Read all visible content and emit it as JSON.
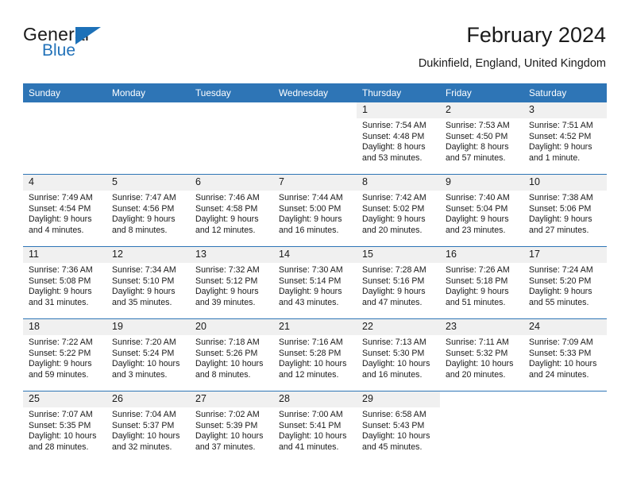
{
  "brand": {
    "name_top": "General",
    "name_bottom": "Blue",
    "triangle_color": "#1d71b8",
    "text_color": "#2272b9"
  },
  "header": {
    "title": "February 2024",
    "location": "Dukinfield, England, United Kingdom"
  },
  "theme": {
    "header_bg": "#2e75b6",
    "header_text": "#ffffff",
    "daynum_bg": "#f0f0f0",
    "row_divider": "#2e75b6",
    "page_bg": "#ffffff"
  },
  "calendar": {
    "weekday_headers": [
      "Sunday",
      "Monday",
      "Tuesday",
      "Wednesday",
      "Thursday",
      "Friday",
      "Saturday"
    ],
    "labels": {
      "sunrise": "Sunrise:",
      "sunset": "Sunset:",
      "daylight": "Daylight:"
    },
    "weeks": [
      [
        {
          "day": "",
          "blank": true
        },
        {
          "day": "",
          "blank": true
        },
        {
          "day": "",
          "blank": true
        },
        {
          "day": "",
          "blank": true
        },
        {
          "day": "1",
          "sunrise": "Sunrise: 7:54 AM",
          "sunset": "Sunset: 4:48 PM",
          "daylight1": "Daylight: 8 hours",
          "daylight2": "and 53 minutes."
        },
        {
          "day": "2",
          "sunrise": "Sunrise: 7:53 AM",
          "sunset": "Sunset: 4:50 PM",
          "daylight1": "Daylight: 8 hours",
          "daylight2": "and 57 minutes."
        },
        {
          "day": "3",
          "sunrise": "Sunrise: 7:51 AM",
          "sunset": "Sunset: 4:52 PM",
          "daylight1": "Daylight: 9 hours",
          "daylight2": "and 1 minute."
        }
      ],
      [
        {
          "day": "4",
          "sunrise": "Sunrise: 7:49 AM",
          "sunset": "Sunset: 4:54 PM",
          "daylight1": "Daylight: 9 hours",
          "daylight2": "and 4 minutes."
        },
        {
          "day": "5",
          "sunrise": "Sunrise: 7:47 AM",
          "sunset": "Sunset: 4:56 PM",
          "daylight1": "Daylight: 9 hours",
          "daylight2": "and 8 minutes."
        },
        {
          "day": "6",
          "sunrise": "Sunrise: 7:46 AM",
          "sunset": "Sunset: 4:58 PM",
          "daylight1": "Daylight: 9 hours",
          "daylight2": "and 12 minutes."
        },
        {
          "day": "7",
          "sunrise": "Sunrise: 7:44 AM",
          "sunset": "Sunset: 5:00 PM",
          "daylight1": "Daylight: 9 hours",
          "daylight2": "and 16 minutes."
        },
        {
          "day": "8",
          "sunrise": "Sunrise: 7:42 AM",
          "sunset": "Sunset: 5:02 PM",
          "daylight1": "Daylight: 9 hours",
          "daylight2": "and 20 minutes."
        },
        {
          "day": "9",
          "sunrise": "Sunrise: 7:40 AM",
          "sunset": "Sunset: 5:04 PM",
          "daylight1": "Daylight: 9 hours",
          "daylight2": "and 23 minutes."
        },
        {
          "day": "10",
          "sunrise": "Sunrise: 7:38 AM",
          "sunset": "Sunset: 5:06 PM",
          "daylight1": "Daylight: 9 hours",
          "daylight2": "and 27 minutes."
        }
      ],
      [
        {
          "day": "11",
          "sunrise": "Sunrise: 7:36 AM",
          "sunset": "Sunset: 5:08 PM",
          "daylight1": "Daylight: 9 hours",
          "daylight2": "and 31 minutes."
        },
        {
          "day": "12",
          "sunrise": "Sunrise: 7:34 AM",
          "sunset": "Sunset: 5:10 PM",
          "daylight1": "Daylight: 9 hours",
          "daylight2": "and 35 minutes."
        },
        {
          "day": "13",
          "sunrise": "Sunrise: 7:32 AM",
          "sunset": "Sunset: 5:12 PM",
          "daylight1": "Daylight: 9 hours",
          "daylight2": "and 39 minutes."
        },
        {
          "day": "14",
          "sunrise": "Sunrise: 7:30 AM",
          "sunset": "Sunset: 5:14 PM",
          "daylight1": "Daylight: 9 hours",
          "daylight2": "and 43 minutes."
        },
        {
          "day": "15",
          "sunrise": "Sunrise: 7:28 AM",
          "sunset": "Sunset: 5:16 PM",
          "daylight1": "Daylight: 9 hours",
          "daylight2": "and 47 minutes."
        },
        {
          "day": "16",
          "sunrise": "Sunrise: 7:26 AM",
          "sunset": "Sunset: 5:18 PM",
          "daylight1": "Daylight: 9 hours",
          "daylight2": "and 51 minutes."
        },
        {
          "day": "17",
          "sunrise": "Sunrise: 7:24 AM",
          "sunset": "Sunset: 5:20 PM",
          "daylight1": "Daylight: 9 hours",
          "daylight2": "and 55 minutes."
        }
      ],
      [
        {
          "day": "18",
          "sunrise": "Sunrise: 7:22 AM",
          "sunset": "Sunset: 5:22 PM",
          "daylight1": "Daylight: 9 hours",
          "daylight2": "and 59 minutes."
        },
        {
          "day": "19",
          "sunrise": "Sunrise: 7:20 AM",
          "sunset": "Sunset: 5:24 PM",
          "daylight1": "Daylight: 10 hours",
          "daylight2": "and 3 minutes."
        },
        {
          "day": "20",
          "sunrise": "Sunrise: 7:18 AM",
          "sunset": "Sunset: 5:26 PM",
          "daylight1": "Daylight: 10 hours",
          "daylight2": "and 8 minutes."
        },
        {
          "day": "21",
          "sunrise": "Sunrise: 7:16 AM",
          "sunset": "Sunset: 5:28 PM",
          "daylight1": "Daylight: 10 hours",
          "daylight2": "and 12 minutes."
        },
        {
          "day": "22",
          "sunrise": "Sunrise: 7:13 AM",
          "sunset": "Sunset: 5:30 PM",
          "daylight1": "Daylight: 10 hours",
          "daylight2": "and 16 minutes."
        },
        {
          "day": "23",
          "sunrise": "Sunrise: 7:11 AM",
          "sunset": "Sunset: 5:32 PM",
          "daylight1": "Daylight: 10 hours",
          "daylight2": "and 20 minutes."
        },
        {
          "day": "24",
          "sunrise": "Sunrise: 7:09 AM",
          "sunset": "Sunset: 5:33 PM",
          "daylight1": "Daylight: 10 hours",
          "daylight2": "and 24 minutes."
        }
      ],
      [
        {
          "day": "25",
          "sunrise": "Sunrise: 7:07 AM",
          "sunset": "Sunset: 5:35 PM",
          "daylight1": "Daylight: 10 hours",
          "daylight2": "and 28 minutes."
        },
        {
          "day": "26",
          "sunrise": "Sunrise: 7:04 AM",
          "sunset": "Sunset: 5:37 PM",
          "daylight1": "Daylight: 10 hours",
          "daylight2": "and 32 minutes."
        },
        {
          "day": "27",
          "sunrise": "Sunrise: 7:02 AM",
          "sunset": "Sunset: 5:39 PM",
          "daylight1": "Daylight: 10 hours",
          "daylight2": "and 37 minutes."
        },
        {
          "day": "28",
          "sunrise": "Sunrise: 7:00 AM",
          "sunset": "Sunset: 5:41 PM",
          "daylight1": "Daylight: 10 hours",
          "daylight2": "and 41 minutes."
        },
        {
          "day": "29",
          "sunrise": "Sunrise: 6:58 AM",
          "sunset": "Sunset: 5:43 PM",
          "daylight1": "Daylight: 10 hours",
          "daylight2": "and 45 minutes."
        },
        {
          "day": "",
          "blank": true
        },
        {
          "day": "",
          "blank": true
        }
      ]
    ]
  }
}
